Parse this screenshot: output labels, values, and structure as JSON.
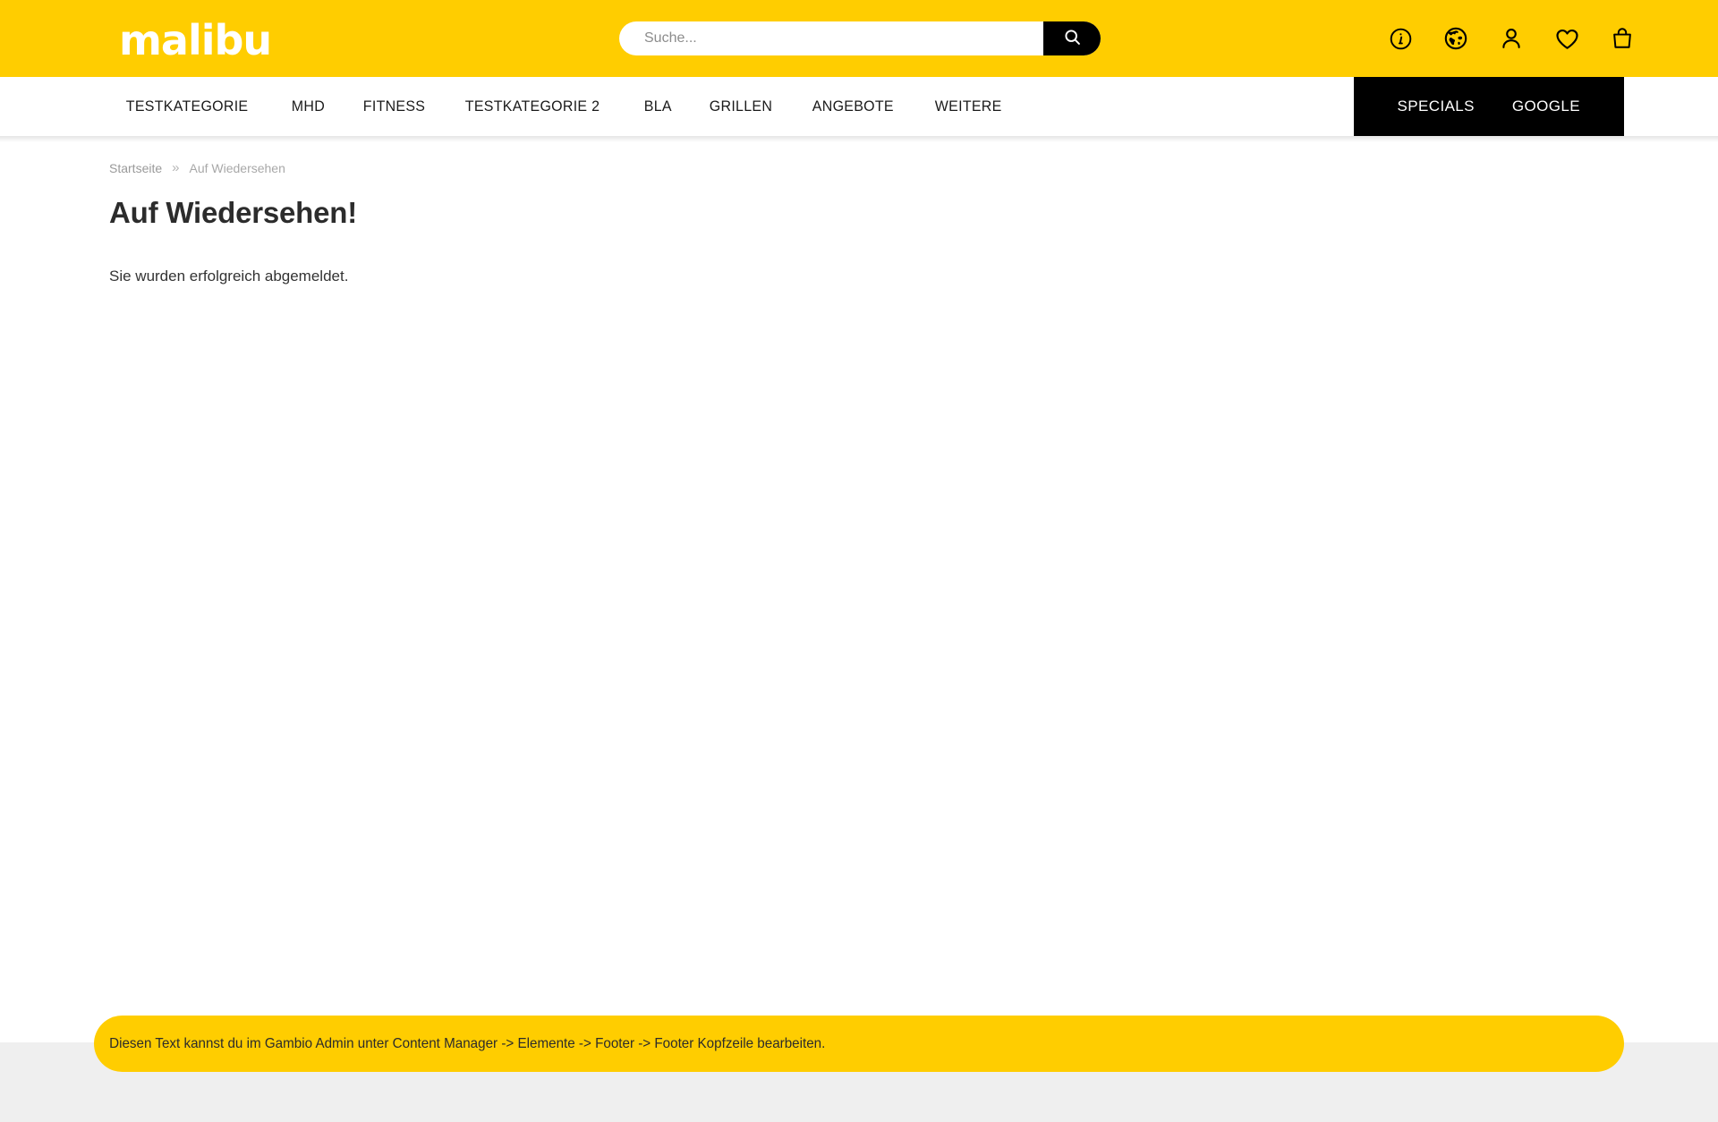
{
  "header": {
    "logo_text": "malibu",
    "brand_yellow": "#FFCD00",
    "search": {
      "placeholder": "Suche...",
      "value": "",
      "button_icon": "search-icon"
    },
    "icons": [
      {
        "name": "info-icon",
        "label": "Informationen"
      },
      {
        "name": "globe-icon",
        "label": "Sprache / Land"
      },
      {
        "name": "account-icon",
        "label": "Mein Konto"
      },
      {
        "name": "wishlist-heart-icon",
        "label": "Merkzettel"
      },
      {
        "name": "cart-bag-icon",
        "label": "Warenkorb"
      }
    ]
  },
  "nav": {
    "items": [
      {
        "label": "TESTKATEGORIE"
      },
      {
        "label": "MHD"
      },
      {
        "label": "FITNESS"
      },
      {
        "label": "TESTKATEGORIE 2"
      },
      {
        "label": "BLA"
      },
      {
        "label": "GRILLEN"
      },
      {
        "label": "ANGEBOTE"
      },
      {
        "label": "WEITERE"
      }
    ],
    "highlighted": [
      {
        "label": "SPECIALS"
      },
      {
        "label": "GOOGLE"
      }
    ]
  },
  "breadcrumb": {
    "home": "Startseite",
    "separator": "»",
    "current": "Auf Wiedersehen"
  },
  "main": {
    "title": "Auf Wiedersehen!",
    "message": "Sie wurden erfolgreich abgemeldet."
  },
  "footer": {
    "banner_text": "Diesen Text kannst du im Gambio Admin unter Content Manager -> Elemente -> Footer -> Footer Kopfzeile bearbeiten.",
    "banner_color": "#FFCD00",
    "background_color": "#efefef"
  }
}
